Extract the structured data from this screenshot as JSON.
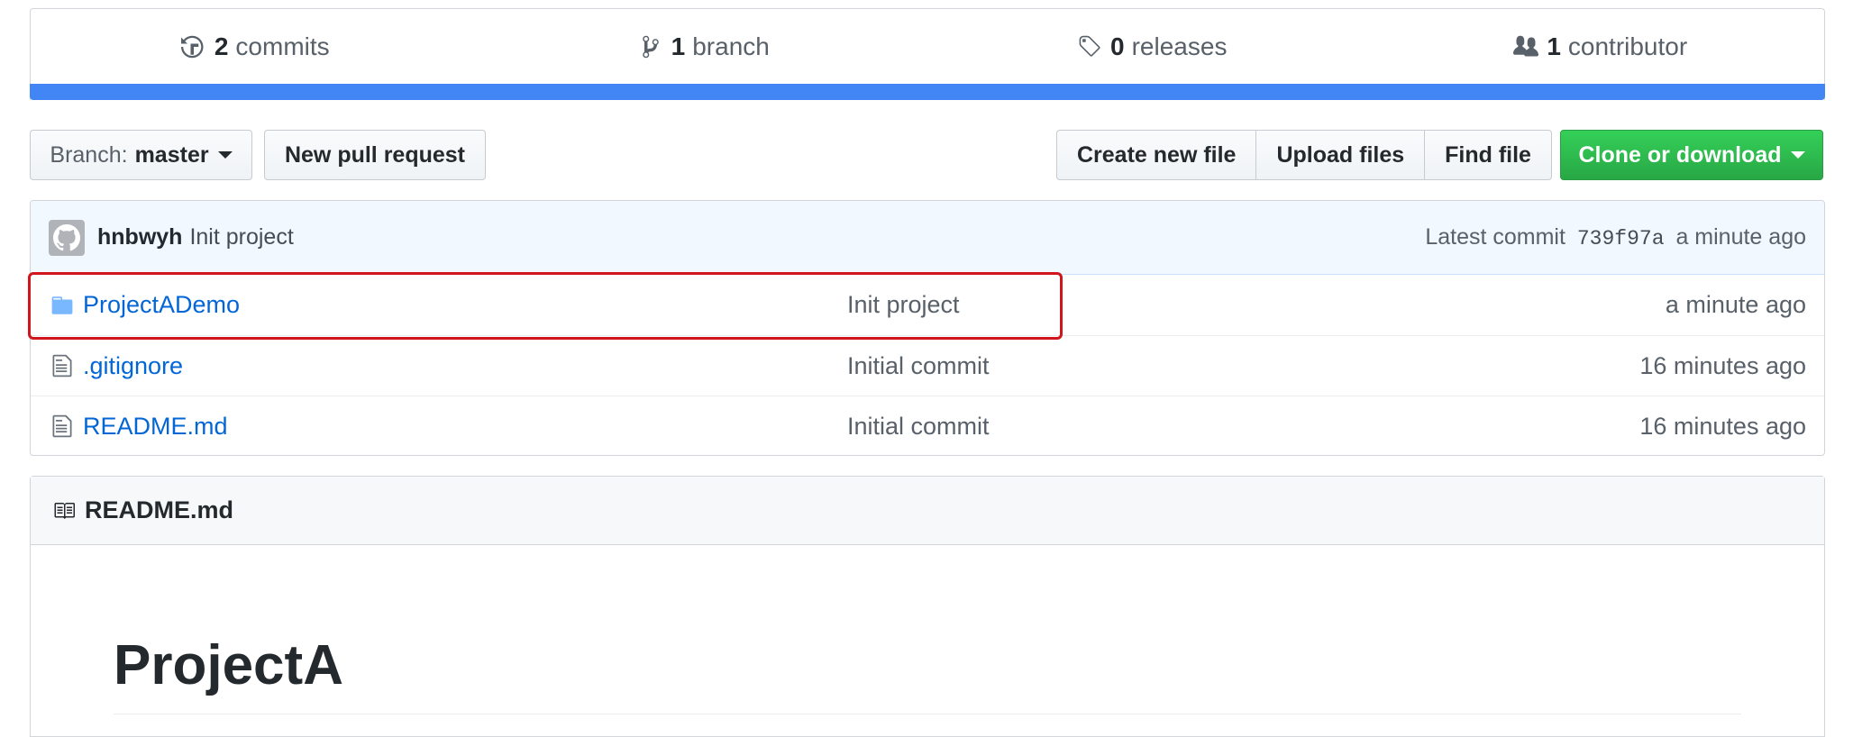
{
  "summary": {
    "commits": {
      "num": "2",
      "label": "commits",
      "icon": "history-icon"
    },
    "branches": {
      "num": "1",
      "label": "branch",
      "icon": "git-branch-icon"
    },
    "releases": {
      "num": "0",
      "label": "releases",
      "icon": "tag-icon"
    },
    "contributors": {
      "num": "1",
      "label": "contributor",
      "icon": "people-icon"
    },
    "language_bar_color": "#4285f4"
  },
  "toolbar": {
    "branch_prefix": "Branch:",
    "branch_name": "master",
    "new_pr": "New pull request",
    "create_file": "Create new file",
    "upload_files": "Upload files",
    "find_file": "Find file",
    "clone": "Clone or download",
    "clone_color": "#28a745"
  },
  "latest_commit": {
    "author": "hnbwyh",
    "message": "Init project",
    "prefix": "Latest commit",
    "sha": "739f97a",
    "age": "a minute ago"
  },
  "files": [
    {
      "type": "folder",
      "name": "ProjectADemo",
      "message": "Init project",
      "age": "a minute ago",
      "highlighted": true
    },
    {
      "type": "file",
      "name": ".gitignore",
      "message": "Initial commit",
      "age": "16 minutes ago"
    },
    {
      "type": "file",
      "name": "README.md",
      "message": "Initial commit",
      "age": "16 minutes ago"
    }
  ],
  "readme": {
    "filename": "README.md",
    "heading": "ProjectA"
  },
  "colors": {
    "link": "#0366d6",
    "highlight_border": "#d0161c"
  }
}
